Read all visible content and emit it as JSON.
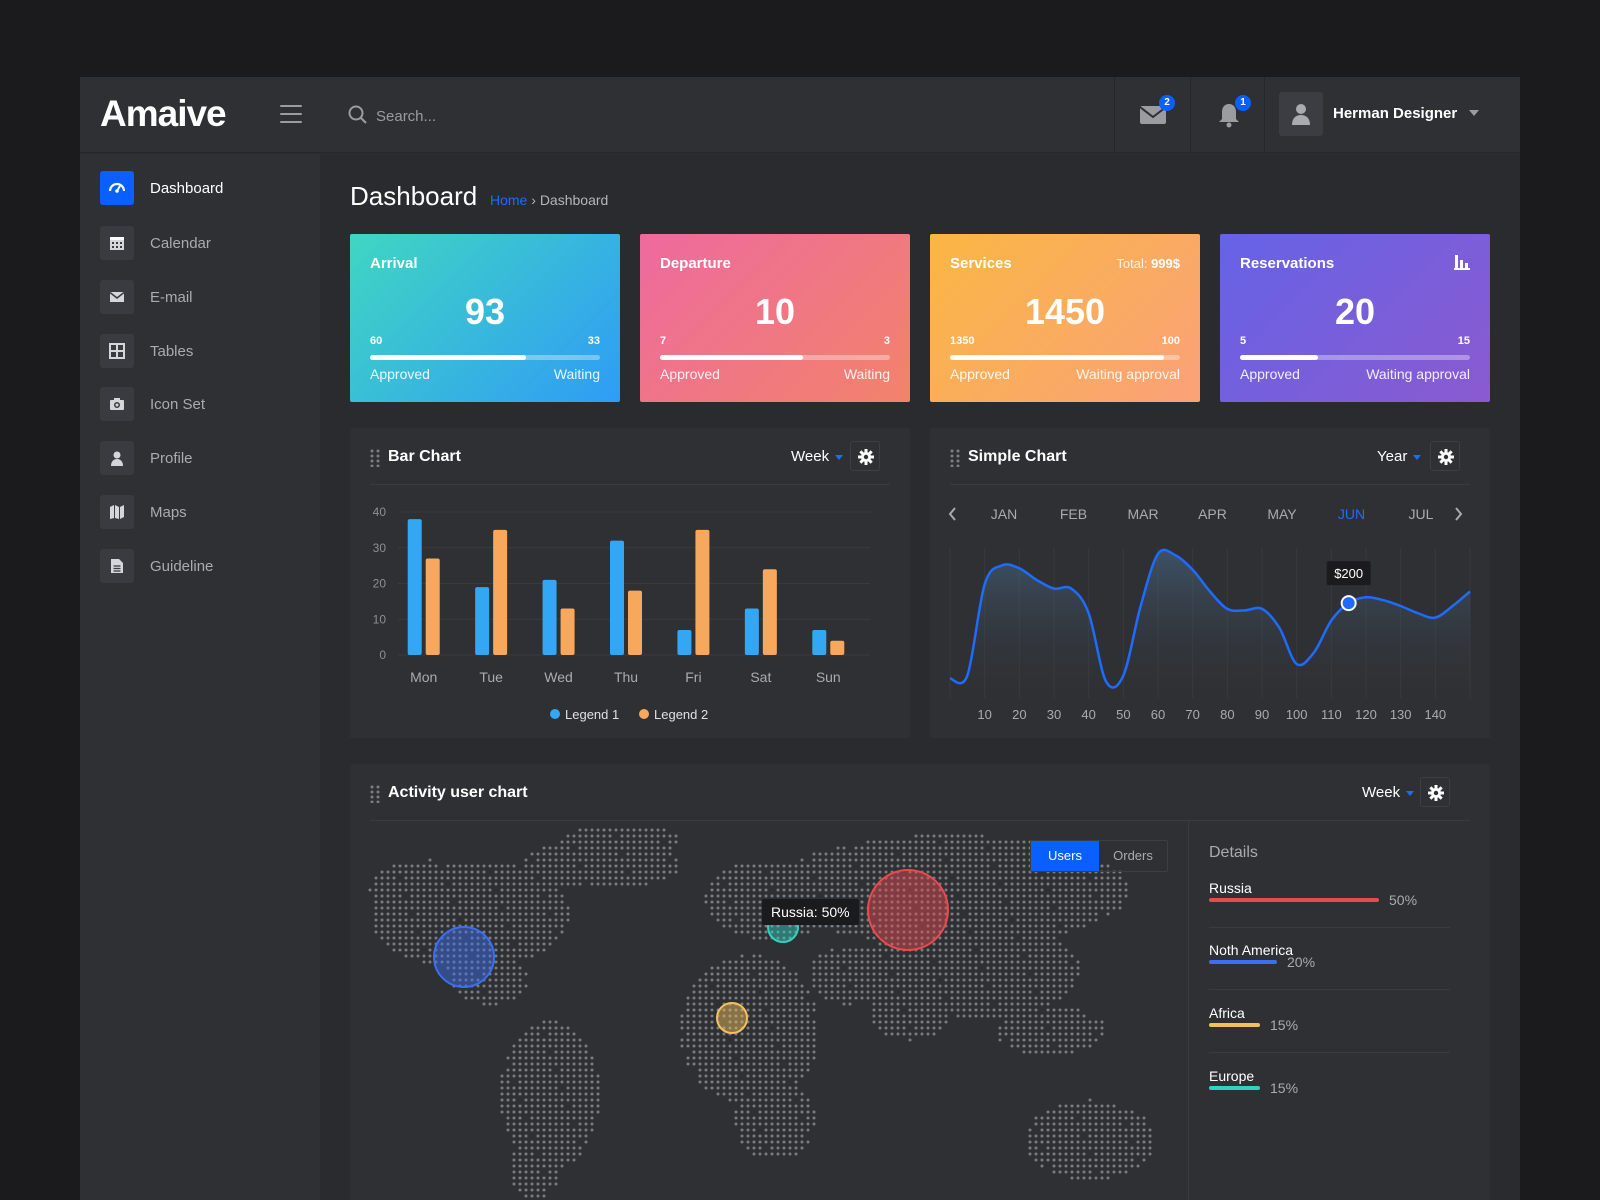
{
  "app": {
    "brand": "Amaive"
  },
  "search": {
    "placeholder": "Search..."
  },
  "header": {
    "mail_badge": "2",
    "notification_badge": "1",
    "user_name": "Herman Designer"
  },
  "sidebar": {
    "items": [
      {
        "label": "Dashboard",
        "icon": "dashboard-icon",
        "active": true
      },
      {
        "label": "Calendar",
        "icon": "calendar-icon"
      },
      {
        "label": "E-mail",
        "icon": "mail-icon"
      },
      {
        "label": "Tables",
        "icon": "table-icon"
      },
      {
        "label": "Icon Set",
        "icon": "camera-icon"
      },
      {
        "label": "Profile",
        "icon": "user-icon"
      },
      {
        "label": "Maps",
        "icon": "map-icon"
      },
      {
        "label": "Guideline",
        "icon": "document-icon"
      }
    ]
  },
  "page": {
    "title": "Dashboard",
    "breadcrumb_home": "Home",
    "breadcrumb_sep": "›",
    "breadcrumb_current": "Dashboard"
  },
  "stats": [
    {
      "title": "Arrival",
      "value": "93",
      "left_num": "60",
      "right_num": "33",
      "left_label": "Approved",
      "right_label": "Waiting",
      "progress": 0.68,
      "gradient": [
        "#40d6c2",
        "#2f9cf5"
      ]
    },
    {
      "title": "Departure",
      "value": "10",
      "left_num": "7",
      "right_num": "3",
      "left_label": "Approved",
      "right_label": "Waiting",
      "progress": 0.62,
      "gradient": [
        "#ee6a9e",
        "#f2836b"
      ]
    },
    {
      "title": "Services",
      "total_label": "Total:",
      "total_value": "999$",
      "value": "1450",
      "left_num": "1350",
      "right_num": "100",
      "left_label": "Approved",
      "right_label": "Waiting approval",
      "progress": 0.93,
      "gradient": [
        "#f9b743",
        "#fba179"
      ]
    },
    {
      "title": "Reservations",
      "icon": "bar-chart-icon",
      "value": "20",
      "left_num": "5",
      "right_num": "15",
      "left_label": "Approved",
      "right_label": "Waiting approval",
      "progress": 0.34,
      "gradient": [
        "#6563e6",
        "#8a5ad0"
      ]
    }
  ],
  "bar_panel": {
    "title": "Bar Chart",
    "period": "Week"
  },
  "simple_panel": {
    "title": "Simple Chart",
    "period": "Year",
    "months": [
      "JAN",
      "FEB",
      "MAR",
      "APR",
      "MAY",
      "JUN",
      "JUL"
    ],
    "active_month": "JUN",
    "tooltip": "$200"
  },
  "activity_panel": {
    "title": "Activity user chart",
    "period": "Week",
    "toggle": [
      "Users",
      "Orders"
    ],
    "active_toggle": "Users",
    "tooltip": "Russia: 50%",
    "details_title": "Details",
    "details": [
      {
        "name": "Russia",
        "pct": "50%",
        "value": 50,
        "color": "#e84a4f"
      },
      {
        "name": "Noth America",
        "pct": "20%",
        "value": 20,
        "color": "#3b6ff0"
      },
      {
        "name": "Africa",
        "pct": "15%",
        "value": 15,
        "color": "#f3c15a"
      },
      {
        "name": "Europe",
        "pct": "15%",
        "value": 15,
        "color": "#30d2c1"
      }
    ],
    "bubbles": [
      {
        "region": "North America",
        "color": "#3b6ff0"
      },
      {
        "region": "Europe",
        "color": "#30d2c1"
      },
      {
        "region": "Africa",
        "color": "#f3c15a"
      },
      {
        "region": "Russia",
        "color": "#e84a4f"
      }
    ]
  },
  "chart_data": [
    {
      "type": "bar",
      "categories": [
        "Mon",
        "Tue",
        "Wed",
        "Thu",
        "Fri",
        "Sat",
        "Sun"
      ],
      "series": [
        {
          "name": "Legend 1",
          "values": [
            38,
            19,
            21,
            32,
            7,
            13,
            7
          ],
          "color": "#33a6f4"
        },
        {
          "name": "Legend 2",
          "values": [
            27,
            35,
            13,
            18,
            35,
            24,
            4
          ],
          "color": "#f7a85c"
        }
      ],
      "ylim": [
        0,
        40
      ],
      "yticks": [
        0,
        10,
        20,
        30,
        40
      ]
    },
    {
      "type": "area",
      "x": [
        0,
        5,
        10,
        15,
        20,
        25,
        30,
        35,
        40,
        45,
        50,
        55,
        60,
        65,
        70,
        75,
        80,
        85,
        90,
        95,
        100,
        105,
        110,
        115,
        120,
        125,
        130,
        135,
        140,
        145,
        150
      ],
      "y": [
        10,
        12,
        75,
        88,
        86,
        78,
        72,
        72,
        55,
        8,
        12,
        60,
        96,
        95,
        85,
        70,
        58,
        57,
        58,
        45,
        20,
        28,
        50,
        62,
        66,
        64,
        60,
        55,
        52,
        60,
        70
      ],
      "xticks": [
        10,
        20,
        30,
        40,
        50,
        60,
        70,
        80,
        90,
        100,
        110,
        120,
        130,
        140
      ],
      "highlight": {
        "x": 115,
        "label": "$200"
      },
      "line_color": "#1e6bff"
    }
  ]
}
